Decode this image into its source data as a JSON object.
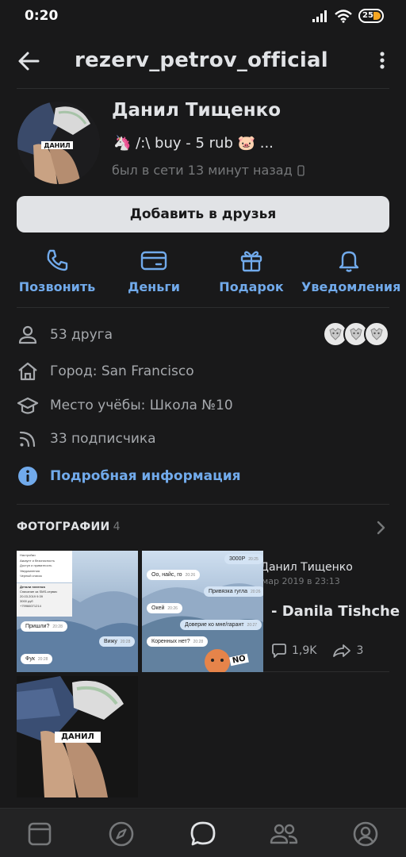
{
  "status_bar": {
    "time": "0:20",
    "battery": "25"
  },
  "header": {
    "title": "rezerv_petrov_official"
  },
  "profile": {
    "name": "Данил Тищенко",
    "status": "🦄 /:\\ buy - 5 rub 🐷 ...",
    "online": "был в сети 13 минут назад",
    "avatar_label": "ДАНИЛ",
    "add_friend": "Добавить в друзья"
  },
  "actions": [
    {
      "label": "Позвонить",
      "icon": "phone-icon"
    },
    {
      "label": "Деньги",
      "icon": "card-icon"
    },
    {
      "label": "Подарок",
      "icon": "gift-icon"
    },
    {
      "label": "Уведомления",
      "icon": "bell-icon"
    }
  ],
  "info": {
    "friends": "53 друга",
    "city": "Город: San Francisco",
    "school": "Место учёбы: Школа №10",
    "followers": "33 подписчика",
    "details": "Подробная информация"
  },
  "photos": {
    "title": "ФОТОГРАФИИ",
    "count": "4",
    "photo1": {
      "menu": [
        "Настройки",
        "Аккаунт и безопасность",
        "Доступ и приватность",
        "Уведомления",
        "Черный список"
      ],
      "card_title": "Детали платежа",
      "card_lines": [
        "Списание за SMS-сервис",
        "20.03.2019 9:39",
        "3000 руб",
        "+79966071214"
      ],
      "bubbles": [
        {
          "text": "Пришли?",
          "time": "20:28",
          "mine": false
        },
        {
          "text": "Вижу",
          "time": "20:28",
          "mine": true
        },
        {
          "text": "Фук",
          "time": "20:28",
          "mine": false
        }
      ]
    },
    "photo2": {
      "bubbles": [
        {
          "text": "3000Р",
          "time": "20:25",
          "mine": true
        },
        {
          "text": "Оо, найс, го",
          "time": "20:26",
          "mine": false
        },
        {
          "text": "Привязка гугла",
          "time": "20:26",
          "mine": true
        },
        {
          "text": "Окей",
          "time": "20:26",
          "mine": false
        },
        {
          "text": "Доверие ко мне/гарант",
          "time": "20:27",
          "mine": true
        },
        {
          "text": "Коренных нет?",
          "time": "20:28",
          "mine": false
        }
      ],
      "sticker_text": "NO"
    },
    "photo3_label": "ДАНИЛ"
  },
  "post_preview": {
    "author": "Данил Тищенко",
    "date": "мар 2019 в 23:13",
    "text": "- Danila Tishche",
    "comments": "1,9K",
    "shares": "3"
  },
  "tab_bar": [
    "news-icon",
    "explore-icon",
    "messages-icon",
    "friends-icon",
    "profile-icon"
  ],
  "colors": {
    "accent": "#71aaeb",
    "background": "#19191a",
    "text": "#e1e3e6",
    "secondary": "#76787a",
    "battery": "#f5a623"
  }
}
